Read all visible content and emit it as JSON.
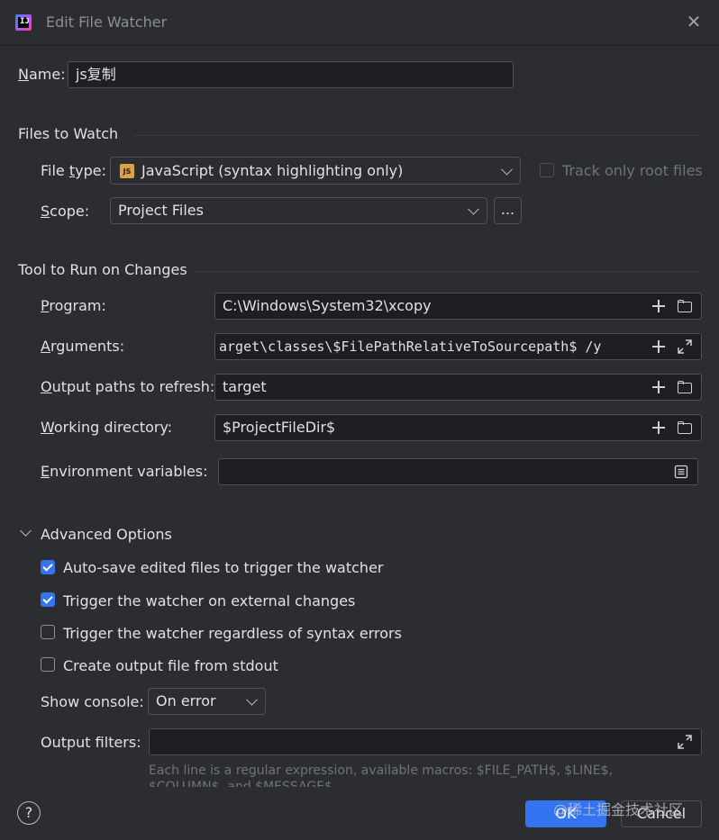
{
  "dialog": {
    "title": "Edit File Watcher",
    "app_icon_text": "IJ"
  },
  "name": {
    "label_pre": "",
    "label_mnemonic": "N",
    "label_post": "ame:",
    "value": "js复制"
  },
  "files_to_watch": {
    "section_title": "Files to Watch",
    "file_type_label_pre": "File ",
    "file_type_label_mnemonic": "t",
    "file_type_label_post": "ype:",
    "file_type_value": "JavaScript (syntax highlighting only)",
    "file_type_badge": "JS",
    "track_only_root_label": "Track only root files",
    "scope_label_mnemonic": "S",
    "scope_label_post": "cope:",
    "scope_value": "Project Files",
    "scope_more": "..."
  },
  "tool": {
    "section_title": "Tool to Run on Changes",
    "program_label_mnemonic": "P",
    "program_label_post": "rogram:",
    "program_value": "C:\\Windows\\System32\\xcopy",
    "arguments_label_mnemonic": "A",
    "arguments_label_post": "rguments:",
    "arguments_value": "arget\\classes\\$FilePathRelativeToSourcepath$ /y",
    "output_paths_label_mnemonic": "O",
    "output_paths_label_post": "utput paths to refresh:",
    "output_paths_value": "target",
    "working_dir_label_mnemonic": "W",
    "working_dir_label_post": "orking directory:",
    "working_dir_value": "$ProjectFileDir$",
    "env_label_mnemonic": "E",
    "env_label_post": "nvironment variables:",
    "env_value": ""
  },
  "advanced": {
    "section_title": "Advanced Options",
    "options": [
      {
        "label": "Auto-save edited files to trigger the watcher",
        "checked": true
      },
      {
        "label": "Trigger the watcher on external changes",
        "checked": true
      },
      {
        "label": "Trigger the watcher regardless of syntax errors",
        "checked": false
      },
      {
        "label": "Create output file from stdout",
        "checked": false
      }
    ],
    "show_console_label": "Show console:",
    "show_console_value": "On error",
    "output_filters_label": "Output filters:",
    "output_filters_value": "",
    "hint_line1": "Each line is a regular expression, available macros: $FILE_PATH$, $LINE$,",
    "hint_line2": "$COLUMN$, and $MESSAGE$"
  },
  "footer": {
    "help": "?",
    "ok": "OK",
    "cancel": "Cancel",
    "watermark": "@稀土掘金技术社区"
  },
  "colors": {
    "background": "#2b2d30",
    "field_bg": "#1e1f22",
    "accent": "#3574f0",
    "border": "#4e5157"
  }
}
